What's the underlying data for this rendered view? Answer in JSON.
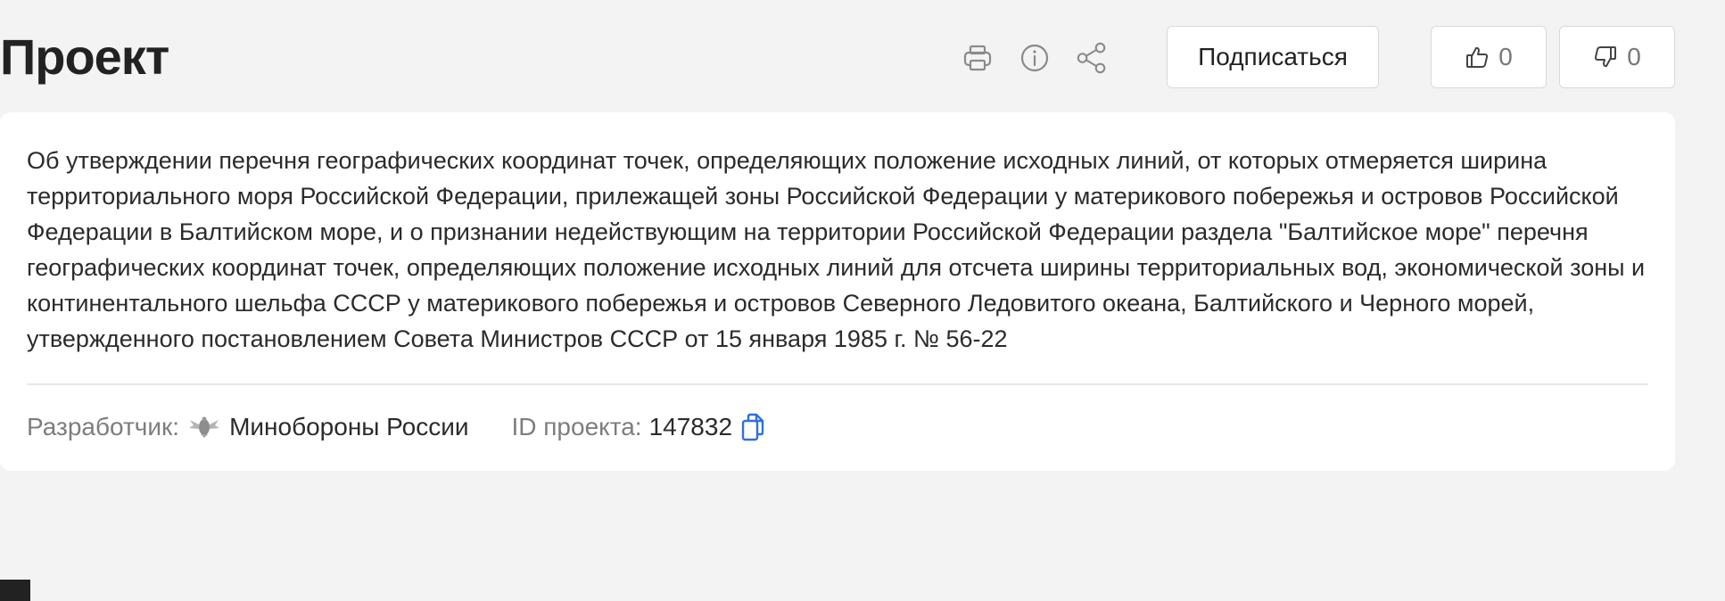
{
  "header": {
    "title": "Проект"
  },
  "toolbar": {
    "icons": [
      "print-icon",
      "info-icon",
      "share-icon"
    ],
    "subscribe_label": "Подписаться",
    "likes": "0",
    "dislikes": "0"
  },
  "project": {
    "description": "Об утверждении перечня географических координат точек, определяющих положение исходных линий, от которых отмеряется ширина территориального моря Российской Федерации, прилежащей зоны Российской Федерации у материкового побережья и островов Российской Федерации в Балтийском море, и о признании недействующим на территории Российской Федерации раздела \"Балтийское море\" перечня географических координат точек, определяющих положение исходных линий для отсчета ширины территориальных вод, экономической зоны и континентального шельфа СССР у материкового побережья и островов Северного Ледовитого океана, Балтийского и Черного морей, утвержденного постановлением Совета Министров СССР от 15 января 1985 г. № 56-22",
    "developer_label": "Разработчик:",
    "developer_name": "Минобороны России",
    "id_label": "ID проекта:",
    "id_value": "147832"
  },
  "colors": {
    "background": "#f3f3f3",
    "card": "#ffffff",
    "accent": "#2f6fdb",
    "muted_text": "#7d7d7d",
    "icon_gray": "#8a8a8a"
  }
}
